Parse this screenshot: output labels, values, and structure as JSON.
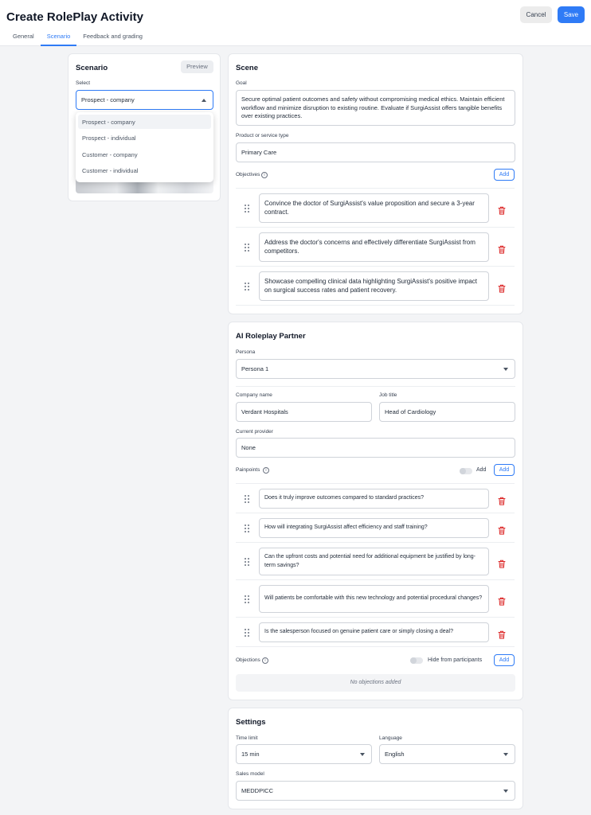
{
  "header": {
    "title": "Create RolePlay Activity",
    "cancel_label": "Cancel",
    "save_label": "Save",
    "accent": "#2f7bf6"
  },
  "tabs": [
    {
      "label": "General",
      "active": false
    },
    {
      "label": "Scenario",
      "active": true
    },
    {
      "label": "Feedback and grading",
      "active": false
    }
  ],
  "scenario": {
    "title": "Scenario",
    "preview_label": "Preview",
    "select_label": "Select",
    "selected": "Prospect - company",
    "options": [
      "Prospect - company",
      "Prospect - individual",
      "Customer - company",
      "Customer - individual"
    ]
  },
  "scene": {
    "title": "Scene",
    "goal_label": "Goal",
    "goal": "Secure optimal patient outcomes and safety without compromising medical ethics. Maintain efficient workflow and minimize disruption to existing routine. Evaluate if SurgiAssist offers tangible benefits over existing practices.",
    "product_label": "Product or service type",
    "product": "Primary Care",
    "objectives_label": "Objectives",
    "add_label": "Add",
    "objectives": [
      "Convince the doctor of SurgiAssist's value proposition and secure a 3-year contract.",
      "Address the doctor's concerns and effectively differentiate SurgiAssist from competitors.",
      "Showcase compelling clinical data highlighting SurgiAssist's positive impact on surgical success rates and patient recovery."
    ]
  },
  "partner": {
    "title": "AI Roleplay Partner",
    "persona_label": "Persona",
    "persona": "Persona 1",
    "company_label": "Company name",
    "company": "Verdant Hospitals",
    "job_label": "Job title",
    "job": "Head of Cardiology",
    "provider_label": "Current provider",
    "provider": "None",
    "painpoints_label": "Painpoints",
    "painpoints_toggle_label": "Add",
    "add_label": "Add",
    "painpoints": [
      "Does it truly improve outcomes compared to standard practices?",
      "How will integrating SurgiAssist affect efficiency and staff training?",
      "Can the upfront costs and potential need for additional equipment be justified by long-term savings?",
      "Will patients be comfortable with this new technology and potential procedural changes?",
      "Is the salesperson focused on genuine patient care or simply closing a deal?"
    ],
    "objections_label": "Objections",
    "hide_label": "Hide from participants",
    "objections_add_label": "Add",
    "no_objections": "No objections added"
  },
  "settings": {
    "title": "Settings",
    "time_label": "Time limit",
    "time": "15 min",
    "language_label": "Language",
    "language": "English",
    "sales_model_label": "Sales model",
    "sales_model": "MEDDPICC"
  },
  "icons": {
    "trash": "trash-icon",
    "drag": "drag-handle-icon",
    "info": "info-icon",
    "trash_color": "#dc2626"
  }
}
